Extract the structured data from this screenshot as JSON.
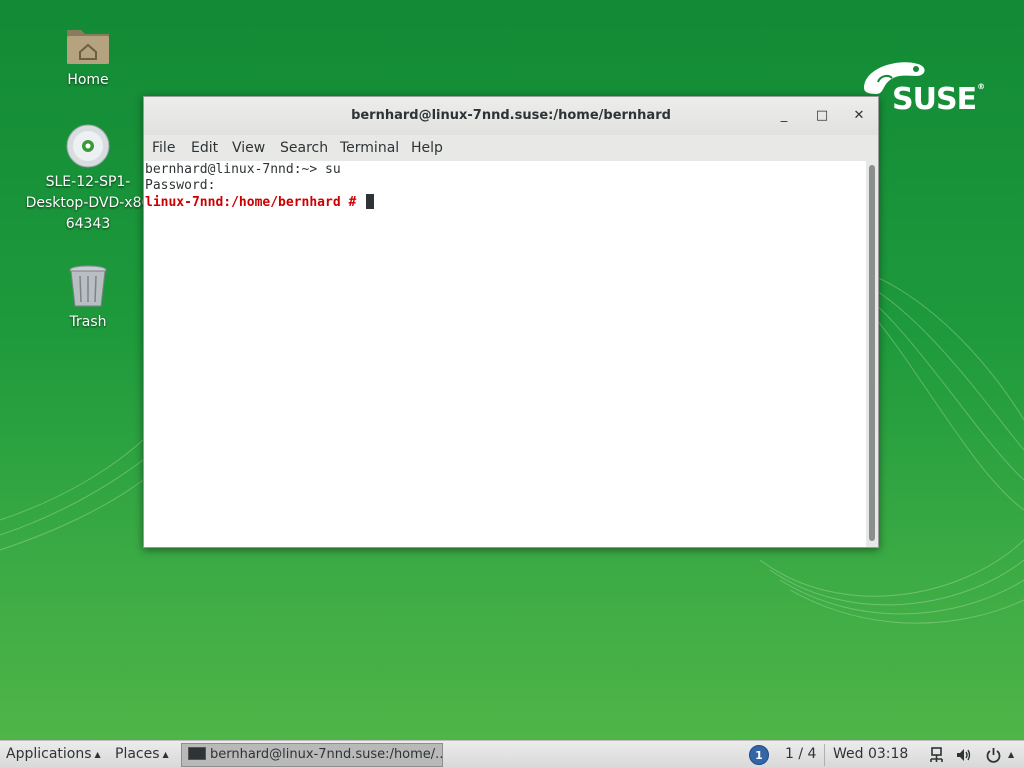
{
  "desktop": {
    "icons": [
      {
        "label": "Home",
        "icon": "home-folder-icon"
      },
      {
        "label_lines": [
          "SLE-12-SP1-",
          "Desktop-DVD-x86",
          "64343"
        ],
        "icon": "dvd-disc-icon"
      },
      {
        "label": "Trash",
        "icon": "trash-icon"
      }
    ],
    "logo_text": "SUSE",
    "brand_color": "#128a36"
  },
  "window": {
    "title": "bernhard@linux-7nnd.suse:/home/bernhard",
    "buttons": {
      "minimize": "_",
      "maximize": "□",
      "close": "✕"
    },
    "menu": [
      "File",
      "Edit",
      "View",
      "Search",
      "Terminal",
      "Help"
    ]
  },
  "terminal": {
    "line1": "bernhard@linux-7nnd:~> su",
    "line2": "Password:",
    "line3_prompt": "linux-7nnd:/home/bernhard #",
    "prompt_color": "#cc0000"
  },
  "panel": {
    "applications": "Applications",
    "places": "Places",
    "task_title": "bernhard@linux-7nnd.suse:/home/...",
    "workspace_badge": "1",
    "workspace": "1 / 4",
    "clock": "Wed 03:18",
    "tray_icons": [
      "network-icon",
      "volume-icon",
      "power-icon"
    ]
  }
}
